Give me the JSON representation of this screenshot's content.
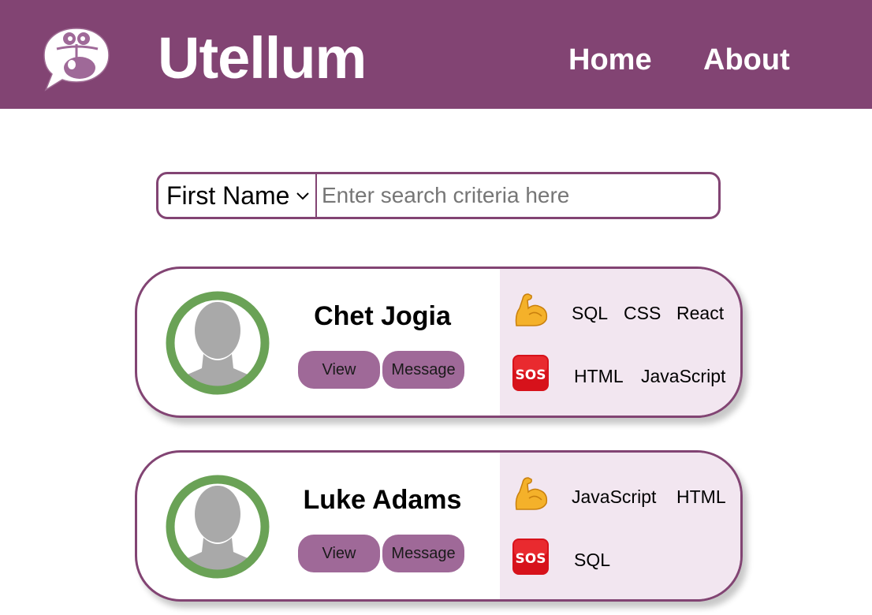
{
  "app": {
    "title": "Utellum"
  },
  "nav": {
    "home": "Home",
    "about": "About"
  },
  "search": {
    "field": "First Name",
    "placeholder": "Enter search criteria here"
  },
  "colors": {
    "brand": "#824473",
    "button": "#9f6998",
    "skills_bg": "#f2e6f0",
    "avatar_ring": "#6aa256"
  },
  "people": [
    {
      "name": "Chet Jogia",
      "view_label": "View",
      "message_label": "Message",
      "strengths_icon": "flexed-biceps-icon",
      "strengths": [
        "SQL",
        "CSS",
        "React"
      ],
      "help_icon": "sos-icon",
      "help_needed": [
        "HTML",
        "JavaScript"
      ]
    },
    {
      "name": "Luke Adams",
      "view_label": "View",
      "message_label": "Message",
      "strengths_icon": "flexed-biceps-icon",
      "strengths": [
        "JavaScript",
        "HTML"
      ],
      "help_icon": "sos-icon",
      "help_needed": [
        "SQL"
      ]
    }
  ]
}
